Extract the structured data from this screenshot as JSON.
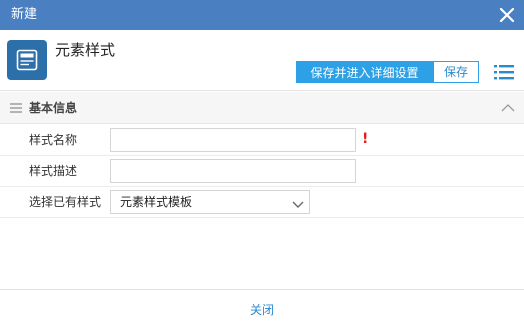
{
  "window": {
    "title": "新建"
  },
  "header": {
    "page_title": "元素样式",
    "save_detail_label": "保存并进入详细设置",
    "save_label": "保存"
  },
  "section": {
    "title": "基本信息"
  },
  "form": {
    "name_label": "样式名称",
    "name_value": "",
    "name_required": "!",
    "desc_label": "样式描述",
    "desc_value": "",
    "existing_label": "选择已有样式",
    "existing_value": "元素样式模板"
  },
  "footer": {
    "close_label": "关闭"
  },
  "colors": {
    "titlebar": "#4a7fc1",
    "primary": "#2ea1e6",
    "link": "#2a8ad0",
    "required": "#e02020"
  }
}
